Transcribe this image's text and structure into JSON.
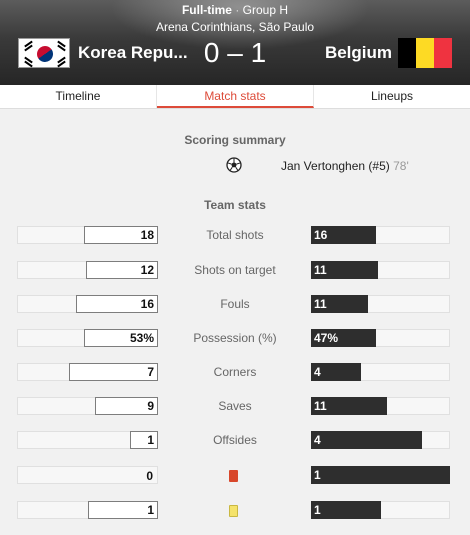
{
  "match": {
    "status": "Full-time",
    "separator": "·",
    "group": "Group H",
    "venue": "Arena Corinthians, São Paulo",
    "home_team": "Korea Repu...",
    "away_team": "Belgium",
    "score": "0 – 1"
  },
  "tabs": [
    {
      "label": "Timeline",
      "active": false
    },
    {
      "label": "Match stats",
      "active": true
    },
    {
      "label": "Lineups",
      "active": false
    }
  ],
  "scoring_summary": {
    "title": "Scoring summary",
    "goals": [
      {
        "icon": "soccer-ball-icon",
        "scorer": "Jan Vertonghen (#5)",
        "minute": "78'"
      }
    ]
  },
  "team_stats": {
    "title": "Team stats",
    "rows": [
      {
        "label": "Total shots",
        "icon": null,
        "home": "18",
        "away": "16",
        "home_frac": 0.53,
        "away_frac": 0.47
      },
      {
        "label": "Shots on target",
        "icon": null,
        "home": "12",
        "away": "11",
        "home_frac": 0.52,
        "away_frac": 0.48
      },
      {
        "label": "Fouls",
        "icon": null,
        "home": "16",
        "away": "11",
        "home_frac": 0.59,
        "away_frac": 0.41
      },
      {
        "label": "Possession (%)",
        "icon": null,
        "home": "53%",
        "away": "47%",
        "home_frac": 0.53,
        "away_frac": 0.47
      },
      {
        "label": "Corners",
        "icon": null,
        "home": "7",
        "away": "4",
        "home_frac": 0.64,
        "away_frac": 0.36
      },
      {
        "label": "Saves",
        "icon": null,
        "home": "9",
        "away": "11",
        "home_frac": 0.45,
        "away_frac": 0.55
      },
      {
        "label": "Offsides",
        "icon": null,
        "home": "1",
        "away": "4",
        "home_frac": 0.2,
        "away_frac": 0.8
      },
      {
        "label": "",
        "icon": "red-card-icon",
        "home": "0",
        "away": "1",
        "home_frac": 0.0,
        "away_frac": 1.0
      },
      {
        "label": "",
        "icon": "yellow-card-icon",
        "home": "1",
        "away": "1",
        "home_frac": 0.5,
        "away_frac": 0.5
      }
    ]
  },
  "colors": {
    "accent": "#dd4b39",
    "away_bar": "#2e2e2e",
    "home_bar": "#ffffff",
    "red_card": "#d8472b",
    "yellow_card": "#f5e36b",
    "belgium_flag": [
      "#000000",
      "#fdda24",
      "#ef3340"
    ]
  }
}
